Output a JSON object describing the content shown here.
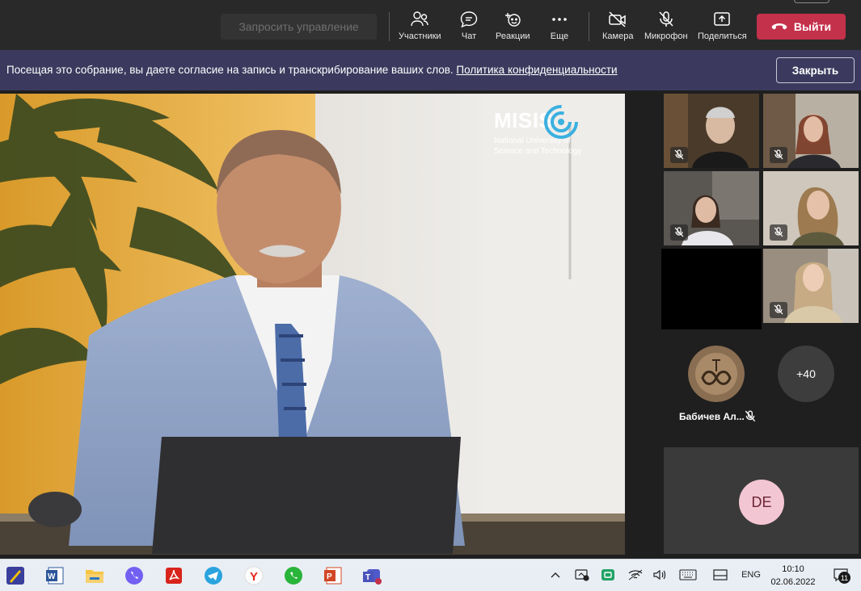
{
  "toolbar": {
    "request_control_label": "Запросить управление",
    "participants_label": "Участники",
    "chat_label": "Чат",
    "reactions_label": "Реакции",
    "more_label": "Еще",
    "camera_label": "Камера",
    "mic_label": "Микрофон",
    "share_label": "Поделиться",
    "leave_label": "Выйти",
    "leave_color": "#c4314b"
  },
  "banner": {
    "message": "Посещая это собрание, вы даете согласие на запись и транскрибирование ваших слов.",
    "link": "Политика конфиденциальности",
    "close_label": "Закрыть",
    "background": "#3b3a5e"
  },
  "main_video": {
    "logo_name": "MISIS",
    "logo_sub_line1": "National University of",
    "logo_sub_line2": "Science and Technology"
  },
  "gallery": {
    "overflow_count": "+40",
    "avatar_name": "Бабичев Ал...",
    "initials": "DE"
  },
  "taskbar": {
    "apps": [
      "app-launcher-icon",
      "word-icon",
      "file-explorer-icon",
      "viber-icon",
      "pdf-reader-icon",
      "telegram-icon",
      "yandex-browser-icon",
      "whatsapp-icon",
      "powerpoint-icon",
      "teams-icon"
    ],
    "language": "ENG",
    "time": "10:10",
    "date": "02.06.2022",
    "notification_count": "11"
  }
}
